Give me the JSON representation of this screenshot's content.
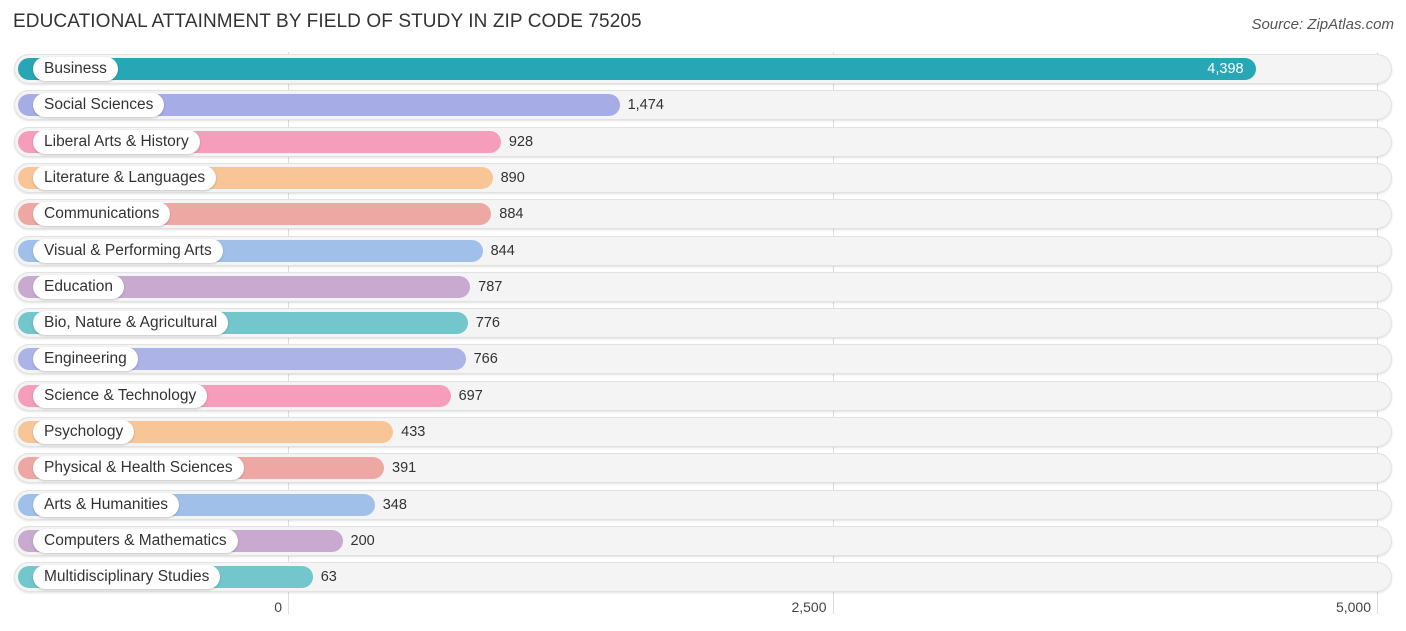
{
  "header": {
    "title": "EDUCATIONAL ATTAINMENT BY FIELD OF STUDY IN ZIP CODE 75205",
    "source": "Source: ZipAtlas.com"
  },
  "chart_data": {
    "type": "bar",
    "orientation": "horizontal",
    "title": "EDUCATIONAL ATTAINMENT BY FIELD OF STUDY IN ZIP CODE 75205",
    "xlabel": "",
    "ylabel": "",
    "xlim": [
      0,
      5000
    ],
    "grid": true,
    "x_ticks": [
      {
        "value": 0,
        "label": "0"
      },
      {
        "value": 2500,
        "label": "2,500"
      },
      {
        "value": 5000,
        "label": "5,000"
      }
    ],
    "categories": [
      "Business",
      "Social Sciences",
      "Liberal Arts & History",
      "Literature & Languages",
      "Communications",
      "Visual & Performing Arts",
      "Education",
      "Bio, Nature & Agricultural",
      "Engineering",
      "Science & Technology",
      "Psychology",
      "Physical & Health Sciences",
      "Arts & Humanities",
      "Computers & Mathematics",
      "Multidisciplinary Studies"
    ],
    "values": [
      4398,
      1474,
      928,
      890,
      884,
      844,
      787,
      776,
      766,
      697,
      433,
      391,
      348,
      200,
      63
    ],
    "value_labels": [
      "4,398",
      "1,474",
      "928",
      "890",
      "884",
      "844",
      "787",
      "776",
      "766",
      "697",
      "433",
      "391",
      "348",
      "200",
      "63"
    ],
    "colors": [
      "#27a6b5",
      "#a6ade6",
      "#f59dba",
      "#f8c597",
      "#eda8a3",
      "#a0c0ea",
      "#c8a9cf",
      "#72c6cc",
      "#abb3e7",
      "#f59dba",
      "#f8c597",
      "#eda8a3",
      "#a0c0ea",
      "#c8a9cf",
      "#72c6cc"
    ]
  }
}
